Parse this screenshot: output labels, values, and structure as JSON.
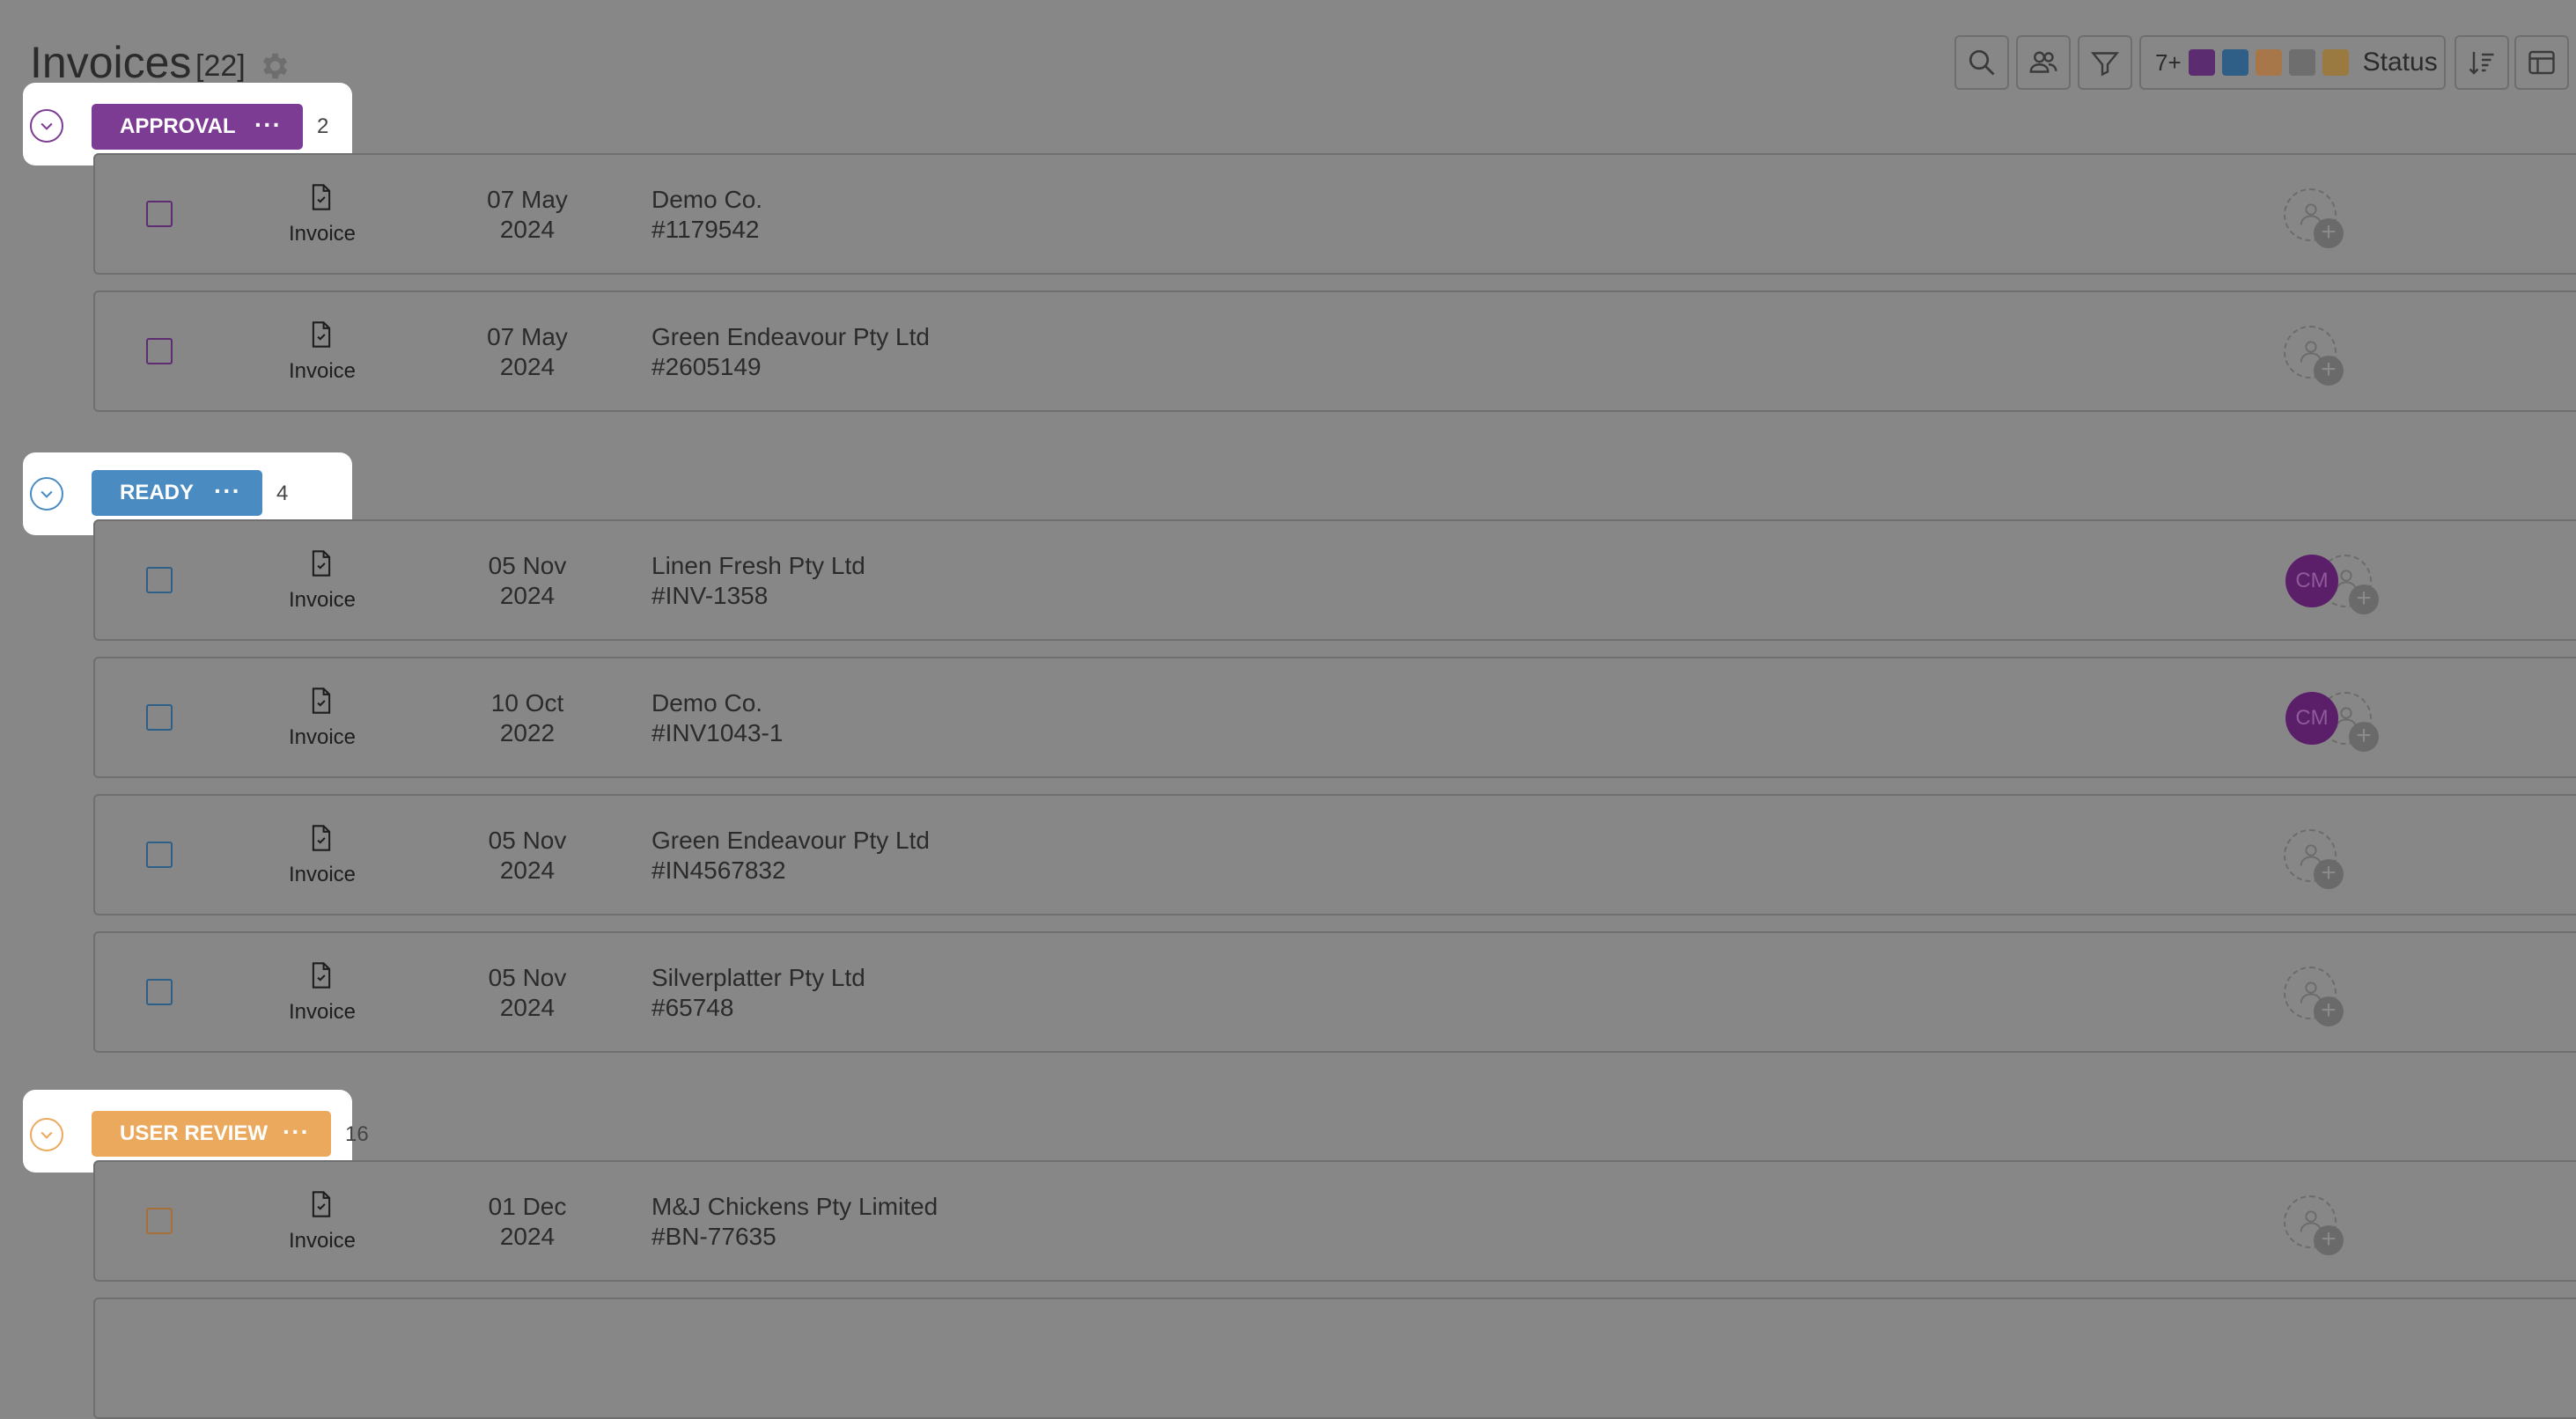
{
  "header": {
    "title": "Invoices",
    "count": "[22]"
  },
  "toolbar": {
    "status_more": "7+",
    "status_label": "Status",
    "swatches": [
      "#5b2c6f",
      "#2f5f86",
      "#a7774a",
      "#6e6e6e",
      "#9a7a40"
    ]
  },
  "groups": [
    {
      "label": "APPROVAL",
      "count": "2",
      "color": "#7d3c94"
    },
    {
      "label": "READY",
      "count": "4",
      "color": "#4a8bc2"
    },
    {
      "label": "USER REVIEW",
      "count": "16",
      "color": "#eba95d"
    }
  ],
  "rows": [
    {
      "type": "Invoice",
      "date_day": "07 May",
      "date_year": "2024",
      "vendor": "Demo Co.",
      "number": "#1179542",
      "assignee": ""
    },
    {
      "type": "Invoice",
      "date_day": "07 May",
      "date_year": "2024",
      "vendor": "Green Endeavour Pty Ltd",
      "number": "#2605149",
      "assignee": ""
    },
    {
      "type": "Invoice",
      "date_day": "05 Nov",
      "date_year": "2024",
      "vendor": "Linen Fresh Pty Ltd",
      "number": "#INV-1358",
      "assignee": "CM"
    },
    {
      "type": "Invoice",
      "date_day": "10 Oct",
      "date_year": "2022",
      "vendor": "Demo Co.",
      "number": "#INV1043-1",
      "assignee": "CM"
    },
    {
      "type": "Invoice",
      "date_day": "05 Nov",
      "date_year": "2024",
      "vendor": "Green Endeavour Pty Ltd",
      "number": "#IN4567832",
      "assignee": ""
    },
    {
      "type": "Invoice",
      "date_day": "05 Nov",
      "date_year": "2024",
      "vendor": "Silverplatter Pty Ltd",
      "number": "#65748",
      "assignee": ""
    },
    {
      "type": "Invoice",
      "date_day": "01 Dec",
      "date_year": "2024",
      "vendor": "M&J Chickens Pty Limited",
      "number": "#BN-77635",
      "assignee": ""
    }
  ]
}
